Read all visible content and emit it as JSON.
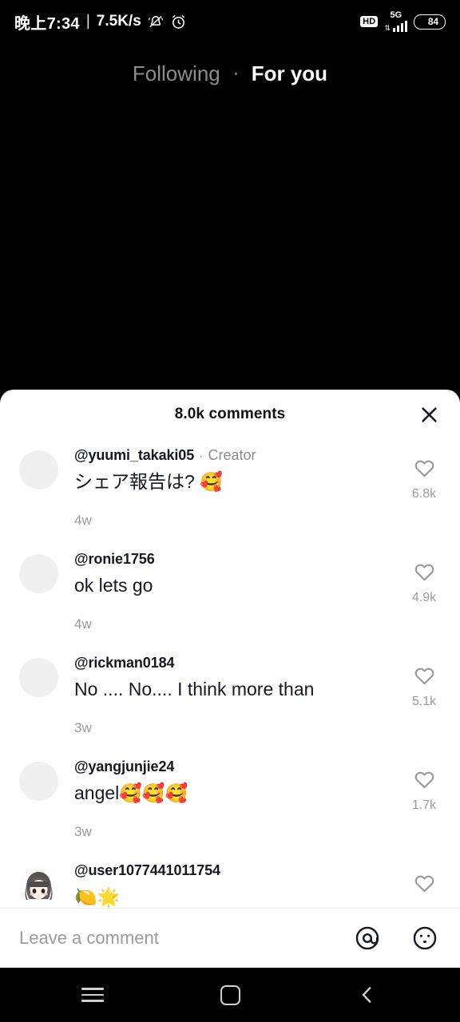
{
  "status_bar": {
    "time": "晚上7:34",
    "separator": "|",
    "network_speed": "7.5K/s",
    "mute_icon": "bell-muted-icon",
    "alarm_icon": "alarm-clock-icon",
    "hd_label": "HD",
    "network_type": "5G",
    "signal_icon": "signal-bars-icon",
    "battery_level": "84"
  },
  "top_tabs": {
    "following_label": "Following",
    "for_you_label": "For you",
    "active": "For you"
  },
  "comment_sheet": {
    "title": "8.0k comments",
    "close_icon": "close-icon",
    "comments": [
      {
        "username": "@yuumi_takaki05",
        "badge": "Creator",
        "badge_separator": "·",
        "text": "シェア報告は? 🥰",
        "time": "4w",
        "likes": "6.8k",
        "avatar": "placeholder"
      },
      {
        "username": "@ronie1756",
        "badge": "",
        "badge_separator": "",
        "text": "ok lets go",
        "time": "4w",
        "likes": "4.9k",
        "avatar": "placeholder"
      },
      {
        "username": "@rickman0184",
        "badge": "",
        "badge_separator": "",
        "text": "No .... No.... I think more than",
        "time": "3w",
        "likes": "5.1k",
        "avatar": "placeholder"
      },
      {
        "username": "@yangjunjie24",
        "badge": "",
        "badge_separator": "",
        "text": "angel🥰🥰🥰",
        "time": "3w",
        "likes": "1.7k",
        "avatar": "placeholder"
      },
      {
        "username": "@user1077441011754",
        "badge": "",
        "badge_separator": "",
        "text": "🍋🌟",
        "time": "",
        "likes": "",
        "avatar": "anime-girl"
      }
    ]
  },
  "input_bar": {
    "placeholder": "Leave a comment",
    "mention_icon": "at-mention-icon",
    "emoji_icon": "emoji-smiley-icon"
  },
  "nav_bar": {
    "recents_icon": "menu-recents-icon",
    "home_icon": "home-square-icon",
    "back_icon": "back-chevron-icon"
  },
  "colors": {
    "background": "#000000",
    "sheet": "#ffffff",
    "text_primary": "#161823",
    "text_muted": "#9a9ba1",
    "avatar_placeholder": "#f0f0f0"
  }
}
